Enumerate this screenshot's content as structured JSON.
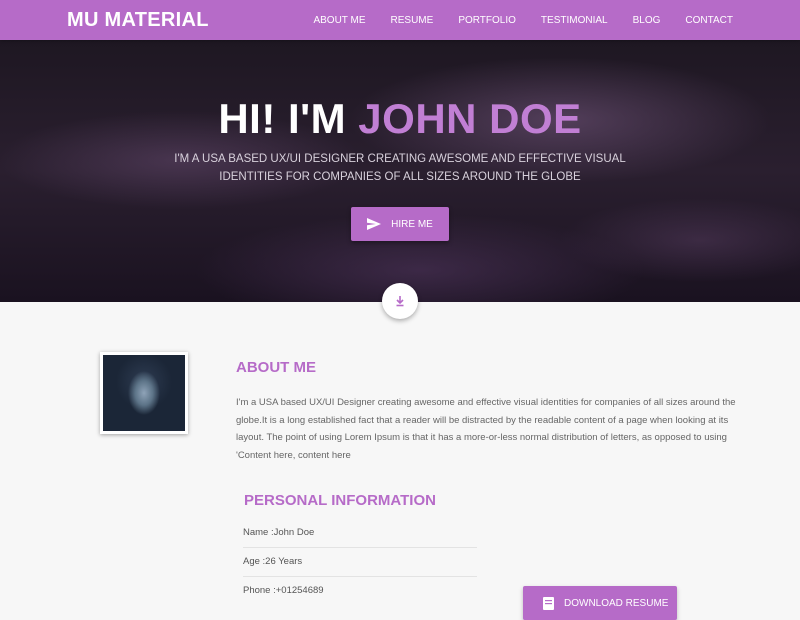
{
  "navbar": {
    "brand": "MU MATERIAL",
    "links": [
      "ABOUT ME",
      "RESUME",
      "PORTFOLIO",
      "TESTIMONIAL",
      "BLOG",
      "CONTACT"
    ]
  },
  "hero": {
    "title_prefix": "HI! I'M ",
    "title_name": "JOHN DOE",
    "subtitle": "I'M A USA BASED UX/UI DESIGNER CREATING AWESOME AND EFFECTIVE VISUAL IDENTITIES FOR COMPANIES OF ALL SIZES AROUND THE GLOBE",
    "hire_label": "HIRE ME",
    "hire_icon": "send-icon",
    "scroll_icon": "download-arrow-icon"
  },
  "about": {
    "title": "ABOUT ME",
    "text": "I'm a USA based UX/UI Designer creating awesome and effective visual identities for companies of all sizes around the globe.It is a long established fact that a reader will be distracted by the readable content of a page when looking at its layout. The point of using Lorem Ipsum is that it has a more-or-less normal distribution of letters, as opposed to using 'Content here, content here"
  },
  "personal": {
    "title": "PERSONAL INFORMATION",
    "rows": [
      "Name :John Doe",
      "Age :26 Years",
      "Phone :+01254689"
    ],
    "download_label": "DOWNLOAD RESUME",
    "download_icon": "document-icon"
  },
  "colors": {
    "accent": "#b66bc8",
    "accent_light": "#c17fd4"
  }
}
